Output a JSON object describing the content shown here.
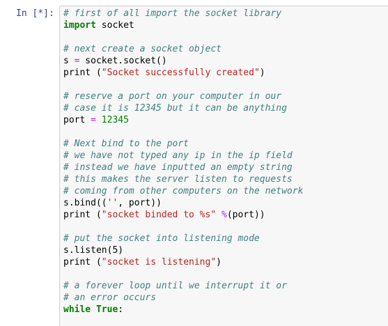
{
  "cell": {
    "prompt": "In [*]:",
    "lines": [
      [
        "# first of all import the socket library"
      ],
      [
        "import",
        " socket"
      ],
      [
        ""
      ],
      [
        "# next create a socket object"
      ],
      [
        "s ",
        "=",
        " socket.socket()"
      ],
      [
        "print (",
        "\"Socket successfully created\"",
        ")"
      ],
      [
        ""
      ],
      [
        "# reserve a port on your computer in our"
      ],
      [
        "# case it is 12345 but it can be anything"
      ],
      [
        "port ",
        "=",
        " ",
        "12345"
      ],
      [
        ""
      ],
      [
        "# Next bind to the port"
      ],
      [
        "# we have not typed any ip in the ip field"
      ],
      [
        "# instead we have inputted an empty string"
      ],
      [
        "# this makes the server listen to requests"
      ],
      [
        "# coming from other computers on the network"
      ],
      [
        "s.bind((",
        "''",
        ", port))"
      ],
      [
        "print (",
        "\"socket binded to %s\"",
        " ",
        "%",
        "(port))"
      ],
      [
        ""
      ],
      [
        "# put the socket into listening mode"
      ],
      [
        "s.listen(5)"
      ],
      [
        "print (",
        "\"socket is listening\"",
        ")"
      ],
      [
        ""
      ],
      [
        "# a forever loop until we interrupt it or"
      ],
      [
        "# an error occurs"
      ],
      [
        "while",
        " ",
        "True",
        ":"
      ]
    ]
  }
}
